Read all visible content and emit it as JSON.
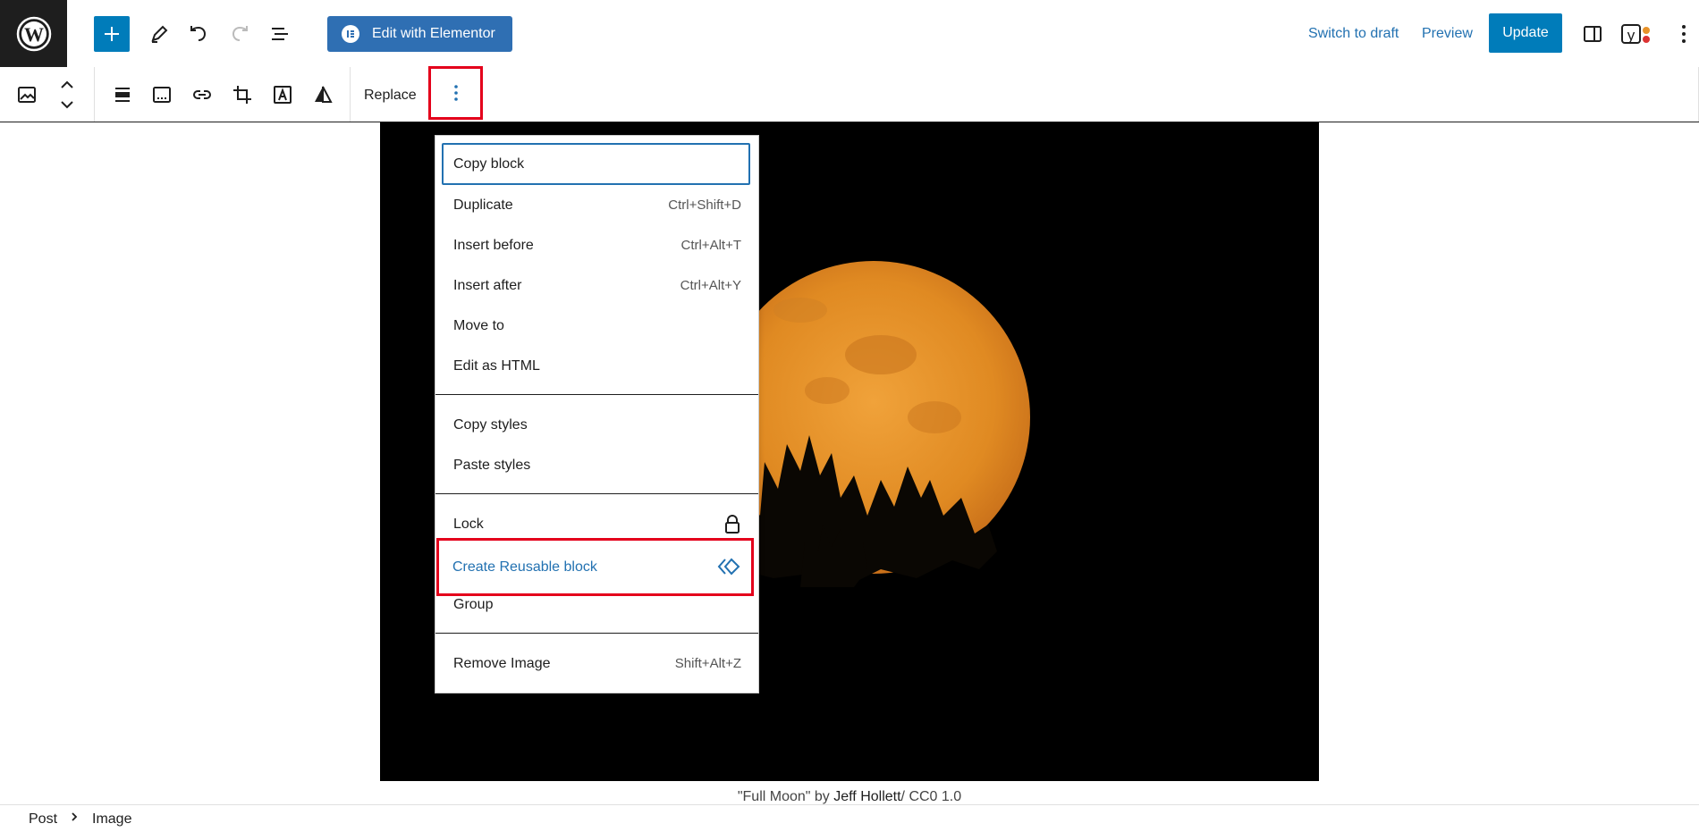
{
  "topbar": {
    "edit_elementor_label": "Edit with Elementor",
    "switch_to_draft": "Switch to draft",
    "preview": "Preview",
    "update": "Update"
  },
  "blocktoolbar": {
    "replace_label": "Replace"
  },
  "menu": {
    "group1": [
      {
        "label": "Copy block",
        "shortcut": ""
      },
      {
        "label": "Duplicate",
        "shortcut": "Ctrl+Shift+D"
      },
      {
        "label": "Insert before",
        "shortcut": "Ctrl+Alt+T"
      },
      {
        "label": "Insert after",
        "shortcut": "Ctrl+Alt+Y"
      },
      {
        "label": "Move to",
        "shortcut": ""
      },
      {
        "label": "Edit as HTML",
        "shortcut": ""
      }
    ],
    "group2": [
      {
        "label": "Copy styles"
      },
      {
        "label": "Paste styles"
      }
    ],
    "group3": [
      {
        "label": "Lock"
      },
      {
        "label": "Create Reusable block"
      },
      {
        "label": "Group"
      }
    ],
    "group4": [
      {
        "label": "Remove Image",
        "shortcut": "Shift+Alt+Z"
      }
    ]
  },
  "image": {
    "caption_prefix": "\"Full Moon\" by ",
    "caption_author": "Jeff Hollett",
    "caption_license": "/ CC0 1.0"
  },
  "breadcrumb": {
    "items": [
      "Post",
      "Image"
    ]
  },
  "colors": {
    "accent": "#007cba",
    "highlight_red": "#e4001b",
    "moon": "#e8922a"
  }
}
